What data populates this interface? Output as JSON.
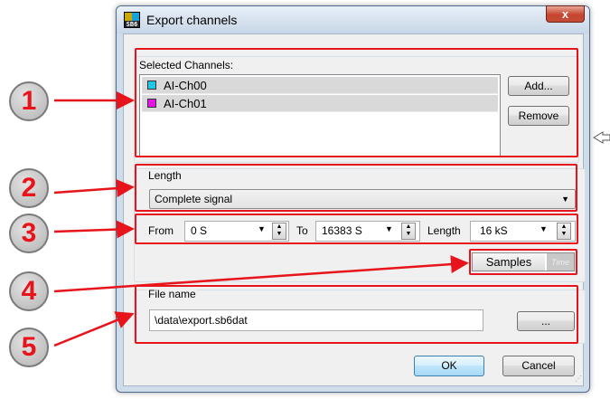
{
  "window": {
    "title": "Export channels",
    "close_glyph": "x",
    "app_icon_text": "SB6"
  },
  "selected_channels": {
    "label": "Selected Channels:",
    "items": [
      {
        "label": "AI-Ch00",
        "color": "#22c7e8"
      },
      {
        "label": "AI-Ch01",
        "color": "#e415e4"
      }
    ],
    "add_label": "Add...",
    "remove_label": "Remove"
  },
  "length": {
    "label": "Length",
    "mode_value": "Complete signal",
    "from_label": "From",
    "from_value": "0 S",
    "to_label": "To",
    "to_value": "16383 S",
    "length_label": "Length",
    "length_value": "16 kS"
  },
  "units_toggle": {
    "samples_label": "Samples",
    "time_label": "Time"
  },
  "file": {
    "label": "File name",
    "value": "\\data\\export.sb6dat",
    "browse_label": "..."
  },
  "footer": {
    "ok_label": "OK",
    "cancel_label": "Cancel"
  },
  "callouts": [
    "1",
    "2",
    "3",
    "4",
    "5"
  ],
  "annotation_color": "#e8141c"
}
